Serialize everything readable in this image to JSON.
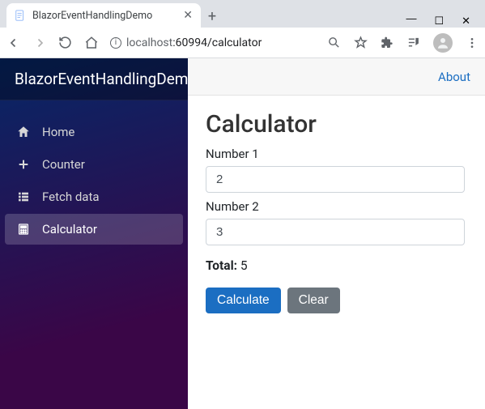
{
  "browser": {
    "tab_title": "BlazorEventHandlingDemo",
    "url_host": "localhost",
    "url_port_path": ":60994/calculator"
  },
  "brand": "BlazorEventHandlingDemo",
  "topbar": {
    "about": "About"
  },
  "sidebar": {
    "items": [
      {
        "label": "Home"
      },
      {
        "label": "Counter"
      },
      {
        "label": "Fetch data"
      },
      {
        "label": "Calculator"
      }
    ]
  },
  "page": {
    "title": "Calculator",
    "label1": "Number 1",
    "value1": "2",
    "label2": "Number 2",
    "value2": "3",
    "total_label": "Total:",
    "total_value": "5",
    "calc_btn": "Calculate",
    "clear_btn": "Clear"
  }
}
